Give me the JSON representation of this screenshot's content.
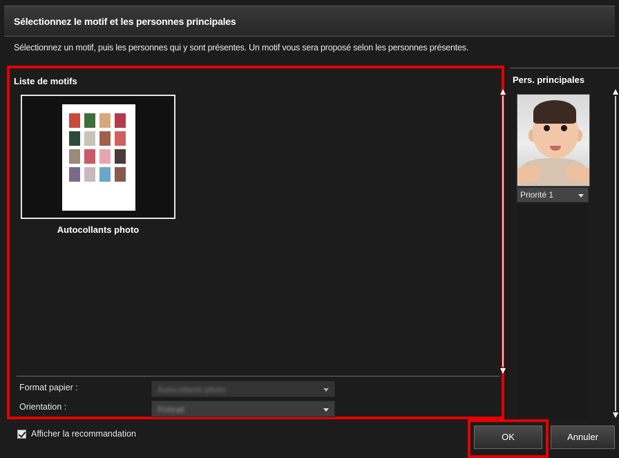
{
  "dialog": {
    "title": "Sélectionnez le motif et les personnes principales",
    "instructions": "Sélectionnez un motif, puis les personnes qui y sont présentes. Un motif vous sera proposé selon les personnes présentes."
  },
  "motif_panel": {
    "title": "Liste de motifs",
    "templates": [
      {
        "label": "Autocollants photo",
        "selected": true
      }
    ],
    "paper_format_label": "Format papier :",
    "paper_format_value": "Autocollants photo",
    "orientation_label": "Orientation :",
    "orientation_value": "Portrait"
  },
  "pers_panel": {
    "title": "Pers. principales",
    "persons": [
      {
        "priority": "Priorité 1"
      }
    ]
  },
  "footer": {
    "show_recommendation_label": "Afficher la recommandation",
    "show_recommendation_checked": true,
    "ok_label": "OK",
    "cancel_label": "Annuler"
  },
  "colors": {
    "highlight": "#e60000",
    "background": "#1c1c1c"
  }
}
